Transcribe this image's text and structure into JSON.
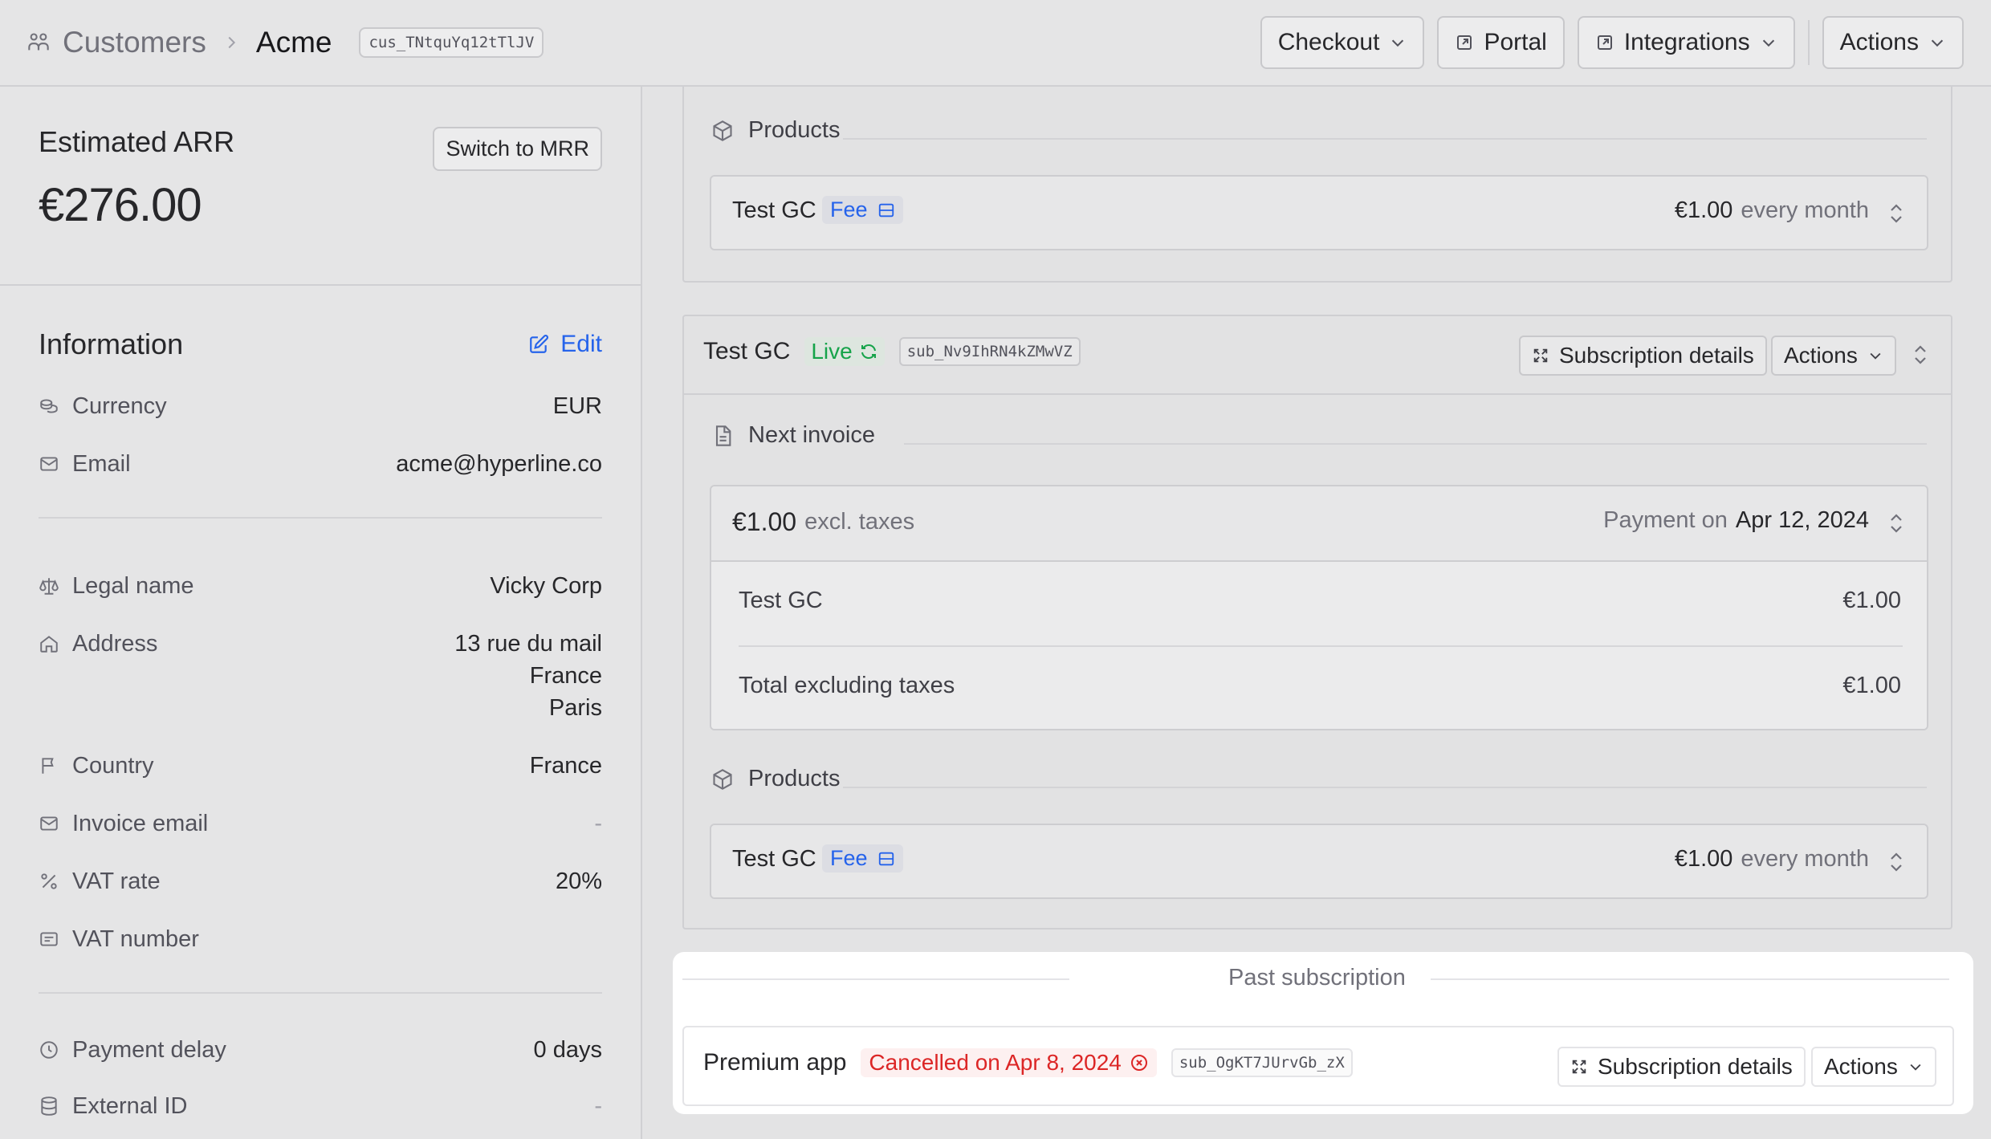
{
  "header": {
    "breadcrumb_parent": "Customers",
    "breadcrumb_current": "Acme",
    "customer_id": "cus_TNtquYq12tTlJV",
    "buttons": {
      "checkout": "Checkout",
      "portal": "Portal",
      "integrations": "Integrations",
      "actions": "Actions"
    }
  },
  "sidebar": {
    "arr": {
      "title": "Estimated ARR",
      "switch_label": "Switch to MRR",
      "value": "€276.00"
    },
    "info": {
      "title": "Information",
      "edit_label": "Edit",
      "currency": {
        "label": "Currency",
        "value": "EUR",
        "icon": "coins-icon"
      },
      "email": {
        "label": "Email",
        "value": "acme@hyperline.co",
        "icon": "mail-icon"
      },
      "legal_name": {
        "label": "Legal name",
        "value": "Vicky Corp",
        "icon": "scale-icon"
      },
      "address": {
        "label": "Address",
        "line1": "13 rue du mail",
        "line2": "France",
        "line3": "Paris",
        "icon": "home-icon"
      },
      "country": {
        "label": "Country",
        "value": "France",
        "icon": "flag-icon"
      },
      "invoice_email": {
        "label": "Invoice email",
        "value": "-",
        "icon": "mail-icon"
      },
      "vat_rate": {
        "label": "VAT rate",
        "value": "20%",
        "icon": "percent-icon"
      },
      "vat_number": {
        "label": "VAT number",
        "value": "",
        "icon": "id-card-icon"
      },
      "payment_delay": {
        "label": "Payment delay",
        "value": "0 days",
        "icon": "clock-icon"
      },
      "external_id": {
        "label": "External ID",
        "value": "-",
        "icon": "database-icon"
      }
    }
  },
  "main": {
    "top_card": {
      "products_label": "Products",
      "product": {
        "name": "Test GC",
        "badge": "Fee",
        "amount": "€1.00",
        "period": "every month"
      }
    },
    "subscription": {
      "name": "Test GC",
      "status": "Live",
      "id": "sub_Nv9IhRN4kZMwVZ",
      "details_label": "Subscription details",
      "actions_label": "Actions",
      "next_invoice_label": "Next invoice",
      "invoice": {
        "amount": "€1.00",
        "tax_note": "excl. taxes",
        "payment_prefix": "Payment on",
        "payment_date": "Apr 12, 2024",
        "lines": [
          {
            "label": "Test GC",
            "value": "€1.00"
          }
        ],
        "total_label": "Total excluding taxes",
        "total_value": "€1.00"
      },
      "products_label": "Products",
      "product": {
        "name": "Test GC",
        "badge": "Fee",
        "amount": "€1.00",
        "period": "every month"
      }
    },
    "past": {
      "title": "Past subscription",
      "name": "Premium app",
      "status": "Cancelled on Apr 8, 2024",
      "id": "sub_OgKT7JUrvGb_zX",
      "details_label": "Subscription details",
      "actions_label": "Actions"
    }
  }
}
